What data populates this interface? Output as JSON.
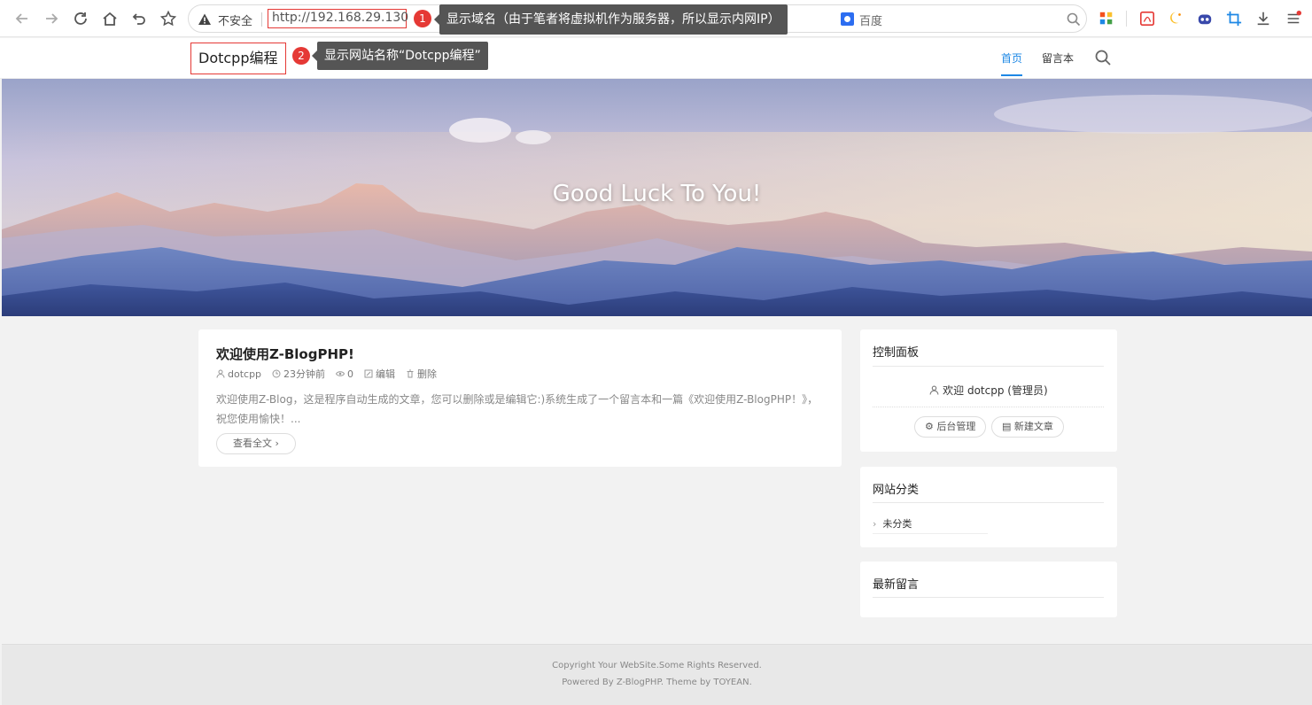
{
  "browser": {
    "insecure_label": "不安全",
    "url": "http://192.168.29.130",
    "search_engine": "百度",
    "ext_icons": [
      "apps-grid-icon",
      "pdf-icon",
      "moon-icon",
      "robot-icon",
      "crop-icon",
      "download-icon",
      "menu-icon"
    ]
  },
  "annotations": [
    {
      "number": "1",
      "text": "显示域名（由于笔者将虚拟机作为服务器，所以显示内网IP）"
    },
    {
      "number": "2",
      "text": "显示网站名称“Dotcpp编程”"
    }
  ],
  "site": {
    "name": "Dotcpp编程",
    "nav": [
      {
        "label": "首页",
        "active": true
      },
      {
        "label": "留言本",
        "active": false
      }
    ],
    "banner_title": "Good Luck To You!"
  },
  "post": {
    "title": "欢迎使用Z-BlogPHP!",
    "author": "dotcpp",
    "time": "23分钟前",
    "views": "0",
    "edit_label": "编辑",
    "delete_label": "删除",
    "excerpt": "欢迎使用Z-Blog，这是程序自动生成的文章，您可以删除或是编辑它:)系统生成了一个留言本和一篇《欢迎使用Z-BlogPHP！》，祝您使用愉快！...",
    "read_more": "查看全文"
  },
  "sidebar": {
    "control_panel": {
      "title": "控制面板",
      "welcome": "欢迎 dotcpp (管理员)",
      "admin_button": "后台管理",
      "new_post_button": "新建文章"
    },
    "categories": {
      "title": "网站分类",
      "items": [
        "未分类"
      ]
    },
    "latest_comments": {
      "title": "最新留言"
    }
  },
  "footer": {
    "copyright": "Copyright Your WebSite.Some Rights Reserved.",
    "powered": "Powered By Z-BlogPHP. Theme by TOYEAN."
  },
  "colors": {
    "accent": "#1e88e5",
    "annotation_red": "#e53935",
    "tooltip_bg": "#555555"
  }
}
